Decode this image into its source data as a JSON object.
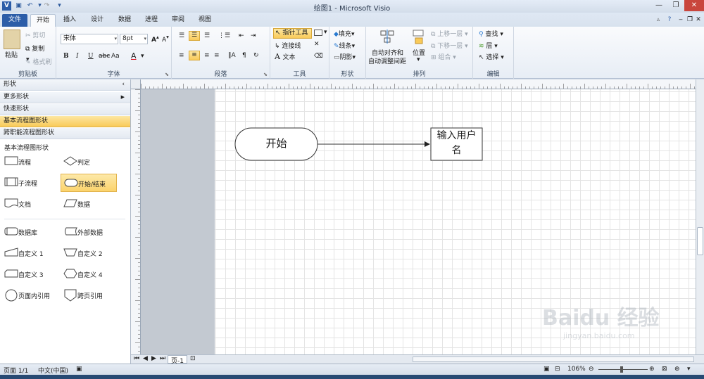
{
  "window": {
    "title": "绘图1 - Microsoft Visio"
  },
  "tabs": [
    {
      "label": "文件"
    },
    {
      "label": "开始"
    },
    {
      "label": "插入"
    },
    {
      "label": "设计"
    },
    {
      "label": "数据"
    },
    {
      "label": "进程"
    },
    {
      "label": "审阅"
    },
    {
      "label": "视图"
    }
  ],
  "clipboard": {
    "paste": "粘贴",
    "cut": "剪切",
    "copy": "复制",
    "format_painter": "格式刷",
    "group_label": "剪贴板"
  },
  "font": {
    "name": "宋体",
    "size": "8pt",
    "bold": "B",
    "italic": "I",
    "underline": "U",
    "strike": "abc",
    "case": "Aa",
    "color": "A",
    "group_label": "字体"
  },
  "paragraph": {
    "group_label": "段落"
  },
  "tools": {
    "pointer": "指针工具",
    "connector": "连接线",
    "text": "文本",
    "group_label": "工具"
  },
  "shape": {
    "fill": "填充",
    "line": "线条",
    "shadow": "阴影",
    "group_label": "形状"
  },
  "arrange": {
    "auto_align": "自动对齐和",
    "auto_space": "自动调整间距",
    "position": "位置",
    "bring_forward": "上移一层",
    "send_backward": "下移一层",
    "group": "组合",
    "group_label": "排列"
  },
  "editing": {
    "find": "查找",
    "layers": "层",
    "select": "选择",
    "group_label": "编辑"
  },
  "shapes_pane": {
    "title": "形状",
    "more_shapes": "更多形状",
    "quick_shapes": "快速形状",
    "basic_flowchart": "基本流程图形状",
    "cross_functional": "跨职能流程图形状",
    "section_title": "基本流程图形状",
    "items": [
      {
        "label": "流程"
      },
      {
        "label": "判定"
      },
      {
        "label": "子流程"
      },
      {
        "label": "开始/结束"
      },
      {
        "label": "文档"
      },
      {
        "label": "数据"
      },
      {
        "label": "数据库"
      },
      {
        "label": "外部数据"
      },
      {
        "label": "自定义 1"
      },
      {
        "label": "自定义 2"
      },
      {
        "label": "自定义 3"
      },
      {
        "label": "自定义 4"
      },
      {
        "label": "页面内引用"
      },
      {
        "label": "跨页引用"
      }
    ]
  },
  "canvas": {
    "start_shape": "开始",
    "process_line1": "输入用户",
    "process_line2": "名",
    "page_tab": "页-1"
  },
  "status": {
    "page": "页面 1/1",
    "language": "中文(中国)",
    "zoom": "106%"
  },
  "watermark": {
    "brand": "Baidu 经验",
    "url": "jingyan.baidu.com"
  },
  "colors": {
    "accent": "#2c5da8",
    "highlight": "#f9ca59"
  }
}
